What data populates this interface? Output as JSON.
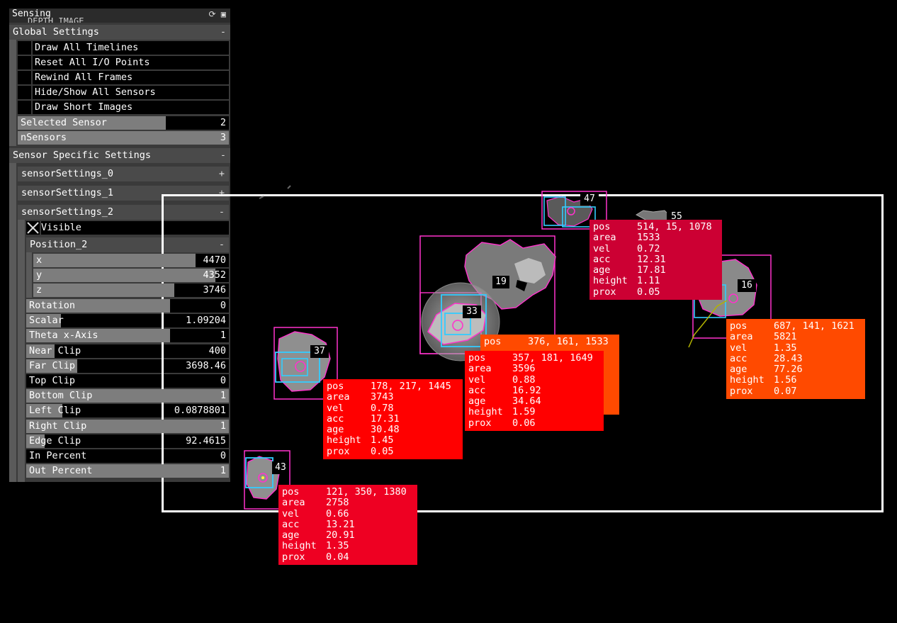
{
  "panel": {
    "title": "Sensing",
    "subtitle": "DEPTH IMAGE",
    "global": {
      "label": "Global Settings",
      "toggle": "-",
      "toggles": [
        {
          "label": "Draw All Timelines"
        },
        {
          "label": "Reset All I/O Points"
        },
        {
          "label": "Rewind All Frames"
        },
        {
          "label": "Hide/Show All Sensors"
        },
        {
          "label": "Draw Short Images"
        }
      ],
      "selected_sensor": {
        "label": "Selected Sensor",
        "value": "2",
        "level": 0.7
      },
      "n_sensors": {
        "label": "nSensors",
        "value": "3",
        "level": 1.0
      }
    },
    "sensor_specific": {
      "label": "Sensor Specific Settings",
      "toggle": "-",
      "settings0": {
        "label": "sensorSettings_0",
        "toggle": "+"
      },
      "settings1": {
        "label": "sensorSettings_1",
        "toggle": "+"
      },
      "settings2": {
        "label": "sensorSettings_2",
        "toggle": "-"
      },
      "visible": {
        "label": "Visible",
        "checked": true
      },
      "position": {
        "label": "Position_2",
        "toggle": "-",
        "x": {
          "label": "x",
          "value": "4470",
          "level": 0.83
        },
        "y": {
          "label": "y",
          "value": "4352",
          "level": 0.93
        },
        "z": {
          "label": "z",
          "value": "3746",
          "level": 0.72
        }
      },
      "params": [
        {
          "label": "Rotation",
          "value": "0",
          "level": 0.71
        },
        {
          "label": "Scalar",
          "value": "1.09204",
          "level": 0.17
        },
        {
          "label": "Theta x-Axis",
          "value": "1",
          "level": 0.71
        },
        {
          "label": "Near Clip",
          "value": "400",
          "level": 0.14
        },
        {
          "label": "Far Clip",
          "value": "3698.46",
          "level": 0.25
        },
        {
          "label": "Top Clip",
          "value": "0",
          "level": 0.0
        },
        {
          "label": "Bottom Clip",
          "value": "1",
          "level": 1.0
        },
        {
          "label": "Left Clip",
          "value": "0.0878801",
          "level": 0.18
        },
        {
          "label": "Right Clip",
          "value": "1",
          "level": 1.0
        },
        {
          "label": "Edge Clip",
          "value": "92.4615",
          "level": 0.09
        },
        {
          "label": "In Percent",
          "value": "0",
          "level": 0.0
        },
        {
          "label": "Out Percent",
          "value": "1",
          "level": 1.0
        }
      ]
    }
  },
  "colors": {
    "blob_outline": "#ff33cc",
    "track_box": "#33ccff",
    "panel_header": "#4a4a4a",
    "info_red": "#ff0000",
    "info_crimson": "#cc0033",
    "info_orange": "#ff4a00"
  },
  "keys": {
    "pos": "pos",
    "area": "area",
    "vel": "vel",
    "acc": "acc",
    "age": "age",
    "height": "height",
    "prox": "prox"
  },
  "blobs": [
    {
      "id": "47",
      "color": "#cc0033",
      "info": {
        "pos": "514, 15, 1078",
        "area": "1533",
        "vel": "0.72",
        "acc": "12.31",
        "age": "17.81",
        "height": "1.11",
        "prox": "0.05"
      }
    },
    {
      "id": "55"
    },
    {
      "id": "19"
    },
    {
      "id": "33",
      "color": "#ff4a00",
      "info": {
        "pos": "376, 161, 1533"
      }
    },
    {
      "id": "16",
      "color": "#ff4a00",
      "info": {
        "pos": "687, 141, 1621",
        "area": "5821",
        "vel": "1.35",
        "acc": "28.43",
        "age": "77.26",
        "height": "1.56",
        "prox": "0.07"
      }
    },
    {
      "id": "37",
      "color": "#ff0000",
      "info": {
        "pos": "178, 217, 1445",
        "area": "3743",
        "vel": "0.78",
        "acc": "17.31",
        "age": "30.48",
        "height": "1.45",
        "prox": "0.05"
      }
    },
    {
      "id": "33b",
      "color": "#ff0000",
      "info": {
        "pos": "357, 181, 1649",
        "area": "3596",
        "vel": "0.88",
        "acc": "16.92",
        "age": "34.64",
        "height": "1.59",
        "prox": "0.06"
      }
    },
    {
      "id": "43",
      "color": "#ee0022",
      "info": {
        "pos": "121, 350, 1380",
        "area": "2758",
        "vel": "0.66",
        "acc": "13.21",
        "age": "20.91",
        "height": "1.35",
        "prox": "0.04"
      }
    }
  ]
}
